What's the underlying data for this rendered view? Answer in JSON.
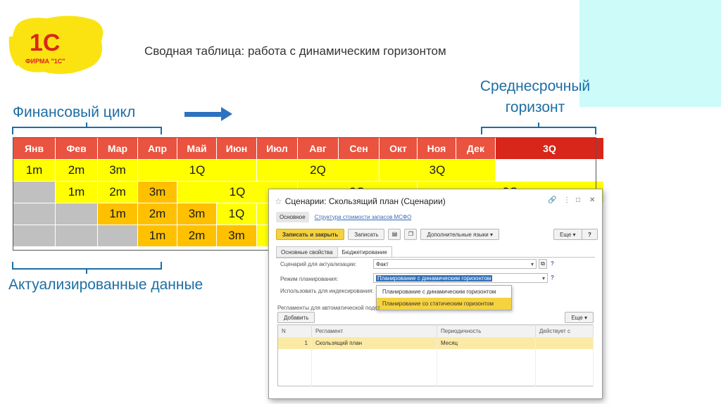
{
  "slide": {
    "title": "Сводная таблица: работа с динамическим горизонтом",
    "label_financial_cycle": "Финансовый цикл",
    "label_medium_term_1": "Среднесрочный",
    "label_medium_term_2": "горизонт",
    "label_actualized": "Актуализированные данные",
    "logo_text_1c": "1С",
    "logo_text_firm": "ФИРМА \"1С\""
  },
  "grid": {
    "headers": [
      "Янв",
      "Фев",
      "Мар",
      "Апр",
      "Май",
      "Июн",
      "Июл",
      "Авг",
      "Сен",
      "Окт",
      "Ноя",
      "Дек",
      "3Q"
    ],
    "rows": [
      [
        "1m",
        "2m",
        "3m",
        "1Q",
        "2Q",
        "3Q"
      ],
      [
        "1m",
        "2m",
        "3m",
        "1Q",
        "2Q",
        "3Q"
      ],
      [
        "1m",
        "2m",
        "3m",
        "1Q"
      ],
      [
        "1m",
        "2m",
        "3m"
      ]
    ]
  },
  "window": {
    "title": "Сценарии: Скользящий план (Сценарии)",
    "tab_main": "Основное",
    "tab_link": "Структура стоимости запасов МСФО",
    "btn_save_close": "Записать и закрыть",
    "btn_save": "Записать",
    "btn_extra_lang": "Дополнительные языки",
    "btn_more": "Еще",
    "btn_help": "?",
    "subtab_1": "Основные свойства",
    "subtab_2": "Бюджетирование",
    "label_scenario": "Сценарий для актуализации:",
    "value_scenario": "Факт",
    "label_mode": "Режим планирования:",
    "value_mode": "Планирование с динамическим горизонтом",
    "label_index": "Использовать для индексирования:",
    "dropdown_options": [
      "Планирование с динамическим горизонтом",
      "Планирование со статическим горизонтом"
    ],
    "label_reglaments": "Регламенты для автоматической подст",
    "btn_add": "Добавить",
    "btn_more2": "Еще",
    "table_headers": [
      "N",
      "Регламент",
      "Периодичность",
      "Действует с"
    ],
    "table_row": {
      "n": "1",
      "reglament": "Скользящий план",
      "period": "Месяц",
      "since": ""
    }
  },
  "colors": {
    "header_red": "#e9533f",
    "q3_red": "#d8261a",
    "yellow": "#ffff00",
    "orange": "#ffc000",
    "gray": "#c0c0c0",
    "blue_text": "#1c6ea4",
    "accent_yellow": "#f5d23f"
  }
}
